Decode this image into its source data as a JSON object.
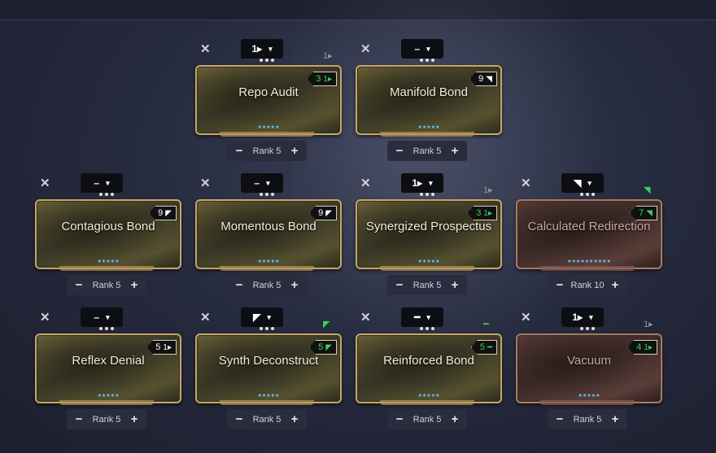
{
  "mods": [
    {
      "name": "Repo Audit",
      "polarity": "1▸",
      "slot_polarity": "1▸",
      "slot_match": false,
      "drain": "3",
      "drain_match": true,
      "drain_icon": "1▸",
      "stars": "★★★★★",
      "rank": "Rank 5",
      "tone": "gold"
    },
    {
      "name": "Manifold Bond",
      "polarity": "–",
      "slot_polarity": "",
      "slot_match": false,
      "drain": "9",
      "drain_match": false,
      "drain_icon": "◥",
      "stars": "★★★★★",
      "rank": "Rank 5",
      "tone": "gold"
    },
    {
      "name": "Contagious Bond",
      "polarity": "–",
      "slot_polarity": "",
      "slot_match": false,
      "drain": "9",
      "drain_match": false,
      "drain_icon": "◤",
      "stars": "★★★★★",
      "rank": "Rank 5",
      "tone": "gold"
    },
    {
      "name": "Momentous Bond",
      "polarity": "–",
      "slot_polarity": "",
      "slot_match": false,
      "drain": "9",
      "drain_match": false,
      "drain_icon": "◤",
      "stars": "★★★★★",
      "rank": "Rank 5",
      "tone": "gold"
    },
    {
      "name": "Synergized Prospectus",
      "polarity": "1▸",
      "slot_polarity": "1▸",
      "slot_match": false,
      "drain": "3",
      "drain_match": true,
      "drain_icon": "1▸",
      "stars": "★★★★★",
      "rank": "Rank 5",
      "tone": "gold"
    },
    {
      "name": "Calculated Redirection",
      "polarity": "◥",
      "slot_polarity": "◥",
      "slot_match": true,
      "drain": "7",
      "drain_match": true,
      "drain_icon": "◥",
      "stars": "★★★★★★★★★★",
      "rank": "Rank 10",
      "tone": "red"
    },
    {
      "name": "Reflex Denial",
      "polarity": "–",
      "slot_polarity": "",
      "slot_match": false,
      "drain": "5",
      "drain_match": false,
      "drain_icon": "1▸",
      "stars": "★★★★★",
      "rank": "Rank 5",
      "tone": "gold"
    },
    {
      "name": "Synth Deconstruct",
      "polarity": "◤",
      "slot_polarity": "◤",
      "slot_match": true,
      "drain": "5",
      "drain_match": true,
      "drain_icon": "◤",
      "stars": "★★★★★",
      "rank": "Rank 5",
      "tone": "gold"
    },
    {
      "name": "Reinforced Bond",
      "polarity": "━",
      "slot_polarity": "━",
      "slot_match": true,
      "drain": "5",
      "drain_match": true,
      "drain_icon": "━",
      "stars": "★★★★★",
      "rank": "Rank 5",
      "tone": "gold"
    },
    {
      "name": "Vacuum",
      "polarity": "1▸",
      "slot_polarity": "1▸",
      "slot_match": false,
      "drain": "4",
      "drain_match": true,
      "drain_icon": "1▸",
      "stars": "★★★★★",
      "rank": "Rank 5",
      "tone": "red"
    }
  ],
  "labels": {
    "remove": "✕",
    "dropdown": "▾",
    "minus": "−",
    "plus": "+"
  }
}
